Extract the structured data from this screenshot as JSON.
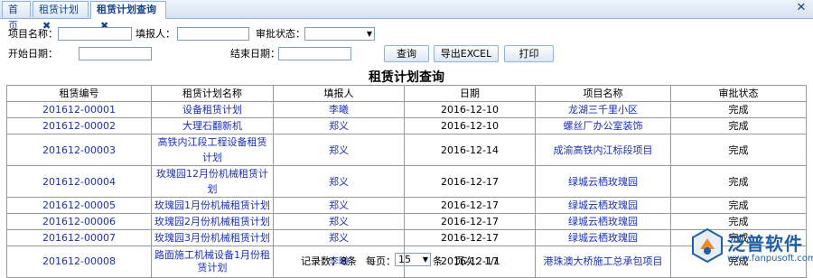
{
  "tabs": [
    {
      "label": "首页",
      "closable": false
    },
    {
      "label": "租赁计划",
      "closable": true
    },
    {
      "label": "租赁计划查询",
      "closable": true,
      "active": true
    }
  ],
  "filters": {
    "project_label": "项目名称：",
    "filler_label": "填报人：",
    "status_label": "审批状态：",
    "start_label": "开始日期：",
    "end_label": "结束日期：",
    "status_value": ""
  },
  "buttons": {
    "query": "查询",
    "export": "导出EXCEL",
    "print": "打印"
  },
  "page_title": "租赁计划查询",
  "table": {
    "headers": [
      "租赁编号",
      "租赁计划名称",
      "填报人",
      "日期",
      "项目名称",
      "审批状态"
    ],
    "rows": [
      {
        "id": "201612-00001",
        "name": "设备租赁计划",
        "filler": "李曦",
        "date": "2016-12-10",
        "project": "龙湖三千里小区",
        "status": "完成"
      },
      {
        "id": "201612-00002",
        "name": "大理石翻新机",
        "filler": "郑义",
        "date": "2016-12-10",
        "project": "螺丝厂办公室装饰",
        "status": "完成"
      },
      {
        "id": "201612-00003",
        "name": "高铁内江段工程设备租赁计划",
        "filler": "郑义",
        "date": "2016-12-14",
        "project": "成渝高铁内江标段项目",
        "status": "完成"
      },
      {
        "id": "201612-00004",
        "name": "玫瑰园12月份机械租赁计划",
        "filler": "郑义",
        "date": "2016-12-17",
        "project": "绿城云栖玫瑰园",
        "status": "完成"
      },
      {
        "id": "201612-00005",
        "name": "玫瑰园1月份机械租赁计划",
        "filler": "郑义",
        "date": "2016-12-17",
        "project": "绿城云栖玫瑰园",
        "status": "完成"
      },
      {
        "id": "201612-00006",
        "name": "玫瑰园2月份机械租赁计划",
        "filler": "郑义",
        "date": "2016-12-17",
        "project": "绿城云栖玫瑰园",
        "status": "完成"
      },
      {
        "id": "201612-00007",
        "name": "玫瑰园3月份机械租赁计划",
        "filler": "郑义",
        "date": "2016-12-17",
        "project": "绿城云栖玫瑰园",
        "status": "完成"
      },
      {
        "id": "201612-00008",
        "name": "路面施工机械设备1月份租赁计划",
        "filler": "李曦",
        "date": "2016-12-17",
        "project": "港珠澳大桥施工总承包项目",
        "status": "完成"
      }
    ]
  },
  "footer": {
    "records": "记录数：8条",
    "per_page_label": "每页：",
    "per_page_value": "15",
    "per_page_unit": "条",
    "page_info": "页次：1/1"
  },
  "watermark": {
    "text": "泛普软件",
    "url": "www.fanpusoft.com"
  },
  "colors": {
    "link": "#1a2fbf",
    "accent": "#15428b",
    "border": "#8db2e3"
  }
}
